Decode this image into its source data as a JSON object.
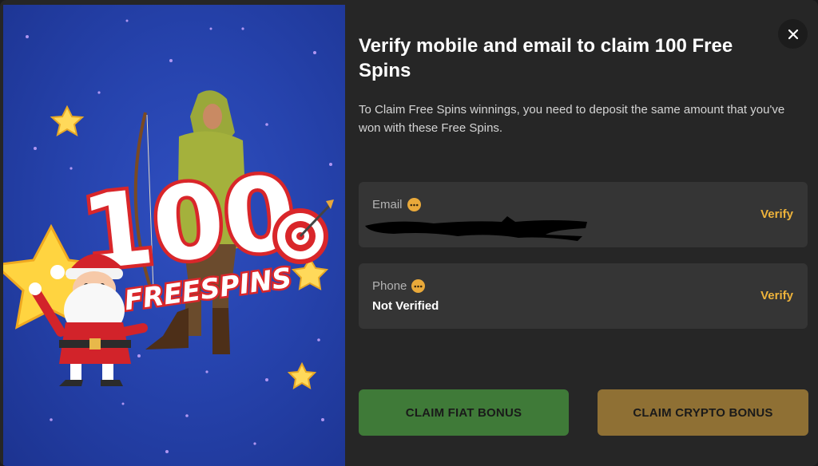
{
  "banner": {
    "big_number": "100",
    "sub_text": "FREESPINS"
  },
  "dialog": {
    "title": "Verify mobile and email to claim 100 Free Spins",
    "description": "To Claim Free Spins winnings, you need to deposit the same amount that you've won with these Free Spins.",
    "close_icon": "close-icon"
  },
  "email": {
    "label": "Email",
    "value_state": "redacted",
    "verify_label": "Verify"
  },
  "phone": {
    "label": "Phone",
    "value": "Not Verified",
    "verify_label": "Verify"
  },
  "buttons": {
    "fiat": "CLAIM FIAT BONUS",
    "crypto": "CLAIM CRYPTO BONUS"
  },
  "colors": {
    "background": "#262626",
    "card": "#353535",
    "accent": "#eeb33b",
    "fiat_button": "#3f7a38",
    "crypto_button": "#8f7034",
    "banner_blue": "#2643ad"
  }
}
